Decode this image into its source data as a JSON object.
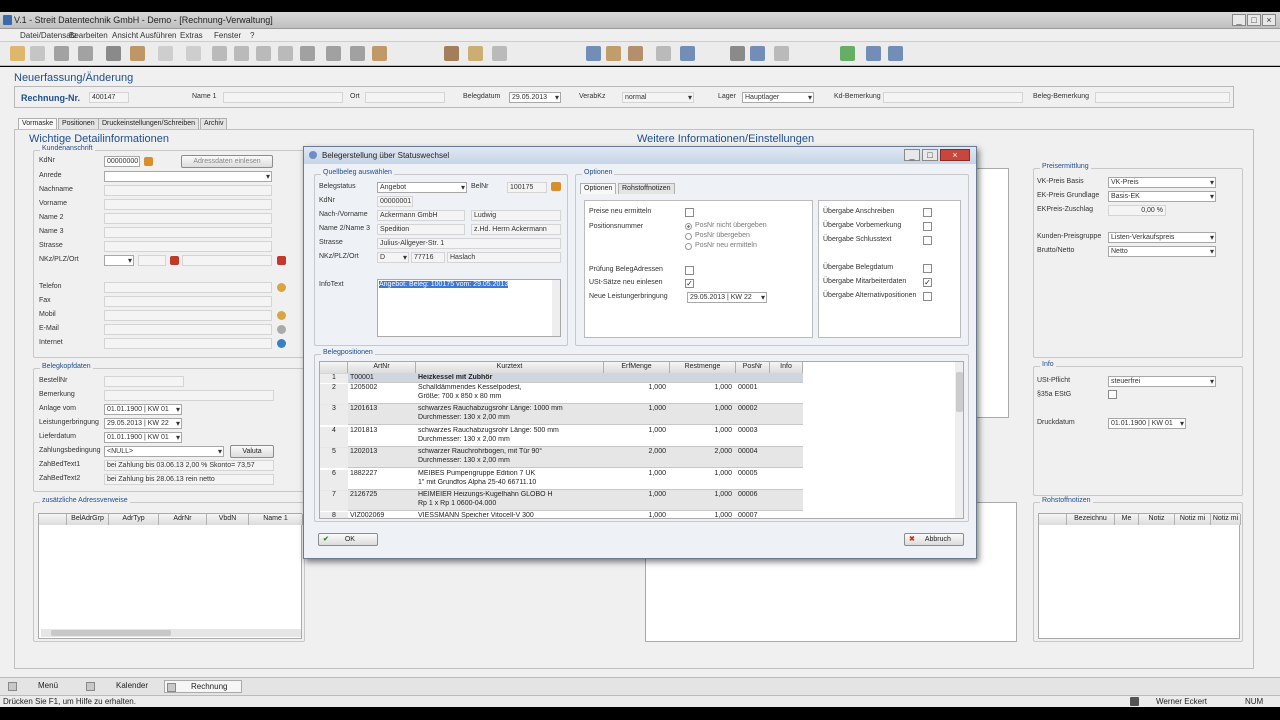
{
  "window": {
    "title": "V.1 - Streit Datentechnik GmbH - Demo - [Rechnung-Verwaltung]"
  },
  "menu": [
    "Datei/Datensatz",
    "Bearbeiten",
    "Ansicht",
    "Ausführen",
    "Extras",
    "Fenster",
    "?"
  ],
  "page": {
    "heading": "Neuerfassung/Änderung",
    "rechnung_label": "Rechnung-Nr.",
    "rechnung_nr": "400147",
    "name1_label": "Name 1",
    "ort_label": "Ort",
    "belegdatum_label": "Belegdatum",
    "belegdatum": "29.05.2013",
    "verabkz_label": "VerabKz",
    "verabkz": "normal",
    "lager_label": "Lager",
    "lager": "Hauptlager",
    "kdbem_label": "Kd-Bemerkung",
    "belegbem_label": "Beleg-Bemerkung"
  },
  "tabs": [
    "Vormaske",
    "Positionen",
    "Druckeinstellungen/Schreiben",
    "Archiv"
  ],
  "left": {
    "heading": "Wichtige Detailinformationen",
    "kunden_title": "Kundenanschrift",
    "kdnr_label": "KdNr",
    "kdnr": "00000000",
    "adress_btn": "Adressdaten einlesen",
    "fields": [
      "Anrede",
      "Nachname",
      "Vorname",
      "Name 2",
      "Name 3",
      "Strasse",
      "NKz/PLZ/Ort"
    ],
    "contact": [
      "Telefon",
      "Fax",
      "Mobil",
      "E-Mail",
      "Internet"
    ],
    "beleg_title": "Belegkopfdaten",
    "bestell_label": "BestellNr",
    "bem_label": "Bemerkung",
    "anlage_label": "Anlage vom",
    "anlage": "01.01.1900 | KW 01",
    "leist_label": "Leistungerbringung",
    "leist": "29.05.2013 | KW 22",
    "liefer_label": "Lieferdatum",
    "liefer": "01.01.1900 | KW 01",
    "zahl_label": "Zahlungsbedingung",
    "zahl": "<NULL>",
    "valuta": "Valuta",
    "zbt1_label": "ZahBedText1",
    "zbt1": "bei Zahlung bis 03.06.13 2,00 % Skonto= 73,57",
    "zbt2_label": "ZahBedText2",
    "zbt2": "bei Zahlung bis 28.06.13 rein netto",
    "zus_title": "zusätzliche Adressverweise",
    "zus_cols": [
      "BelAdrGrp",
      "AdrTyp",
      "AdrNr",
      "VbdN",
      "Name 1"
    ]
  },
  "right": {
    "heading": "Weitere Informationen/Einstellungen",
    "preis_title": "Preisermittlung",
    "vk_label": "VK-Preis Basis",
    "vk": "VK-Preis",
    "ek_label": "EK-Preis Grundlage",
    "ek": "Basis-EK",
    "ekz_label": "EKPreis-Zuschlag",
    "ekz": "0,00 %",
    "kpg_label": "Kunden-Preisgruppe",
    "kpg": "Listen-Verkaufspreis",
    "bn_label": "Brutto/Netto",
    "bn": "Netto",
    "info_title": "Info",
    "ust_label": "USt-Pflicht",
    "ust": "steuerfrei",
    "estg_label": "§35a EStG",
    "druck_label": "Druckdatum",
    "druck": "01.01.1900 | KW 01",
    "roh_title": "Rohstoffnotizen",
    "roh_cols": [
      "Bezeichnu",
      "Me",
      "Notiz",
      "Notiz mi",
      "Notiz mi"
    ]
  },
  "dialog": {
    "title": "Belegerstellung über Statuswechsel",
    "quell_title": "Quellbeleg auswählen",
    "belegstatus_label": "Belegstatus",
    "belegstatus": "Angebot",
    "belnr_label": "BelNr",
    "belnr": "100175",
    "kdnr_label": "KdNr",
    "kdnr": "00000001",
    "name_label": "Nach-/Vorname",
    "nach": "Ackermann GmbH",
    "vor": "Ludwig",
    "name2_label": "Name 2/Name 3",
    "name2": "Spedition",
    "name3": "z.Hd. Herrn Ackermann",
    "strasse_label": "Strasse",
    "strasse": "Julius-Allgeyer-Str. 1",
    "plz_label": "NKz/PLZ/Ort",
    "nkz": "D",
    "plz": "77716",
    "ort": "Haslach",
    "info_label": "InfoText",
    "info": "Angebot: Beleg: 100175 vom: 29.05.2013",
    "opt_title": "Optionen",
    "opt_tabs": [
      "Optionen",
      "Rohstoffnotizen"
    ],
    "opts_left": [
      {
        "l": "Preise neu ermitteln",
        "c": ""
      },
      {
        "l": "Prüfung BelegAdressen",
        "c": ""
      },
      {
        "l": "USt-Sätze neu einlesen",
        "c": "✓"
      }
    ],
    "posnr_label": "Positionsnummer",
    "radios": [
      "PosNr nicht übergeben",
      "PosNr übergeben",
      "PosNr neu ermitteln"
    ],
    "leist_label": "Neue Leistungerbringung",
    "leist": "29.05.2013 | KW 22",
    "opts_right": [
      {
        "l": "Übergabe Anschreiben",
        "c": ""
      },
      {
        "l": "Übergabe Vorbemerkung",
        "c": ""
      },
      {
        "l": "Übergabe Schlusstext",
        "c": ""
      },
      {
        "l": "Übergabe Belegdatum",
        "c": ""
      },
      {
        "l": "Übergabe Mitarbeiterdaten",
        "c": "✓"
      },
      {
        "l": "Übergabe Alternativpositionen",
        "c": ""
      }
    ],
    "pos_title": "Belegpositionen",
    "cols": [
      "ArtNr",
      "Kurztext",
      "ErfMenge",
      "Restmenge",
      "PosNr",
      "Info"
    ],
    "rows": [
      {
        "n": "1",
        "art": "T00001",
        "t1": "Heizkessel mit Zubhör",
        "t2": "",
        "erf": "",
        "rest": "",
        "pos": "",
        "bold": true
      },
      {
        "n": "2",
        "art": "1205002",
        "t1": "Schalldämmendes Kesselpodest,",
        "t2": "Größe:  700 x 850 x 80 mm",
        "erf": "1,000",
        "rest": "1,000",
        "pos": "00001"
      },
      {
        "n": "3",
        "art": "1201613",
        "t1": "schwarzes Rauchabzugsrohr Länge: 1000 mm",
        "t2": "Durchmesser:  130 x 2,00 mm",
        "erf": "1,000",
        "rest": "1,000",
        "pos": "00002"
      },
      {
        "n": "4",
        "art": "1201813",
        "t1": "schwarzes Rauchabzugsrohr Länge:  500 mm",
        "t2": "Durchmesser:  130 x 2,00 mm",
        "erf": "1,000",
        "rest": "1,000",
        "pos": "00003"
      },
      {
        "n": "5",
        "art": "1202013",
        "t1": "schwarzer Rauchrohrbogen, mit Tür    90°",
        "t2": "Durchmesser:  130 x 2,00 mm",
        "erf": "2,000",
        "rest": "2,000",
        "pos": "00004"
      },
      {
        "n": "6",
        "art": "1882227",
        "t1": "MEIBES Pumpengruppe Edition 7 UK",
        "t2": "1\" mit Grundfos Alpha 25-40     66711.10",
        "erf": "1,000",
        "rest": "1,000",
        "pos": "00005"
      },
      {
        "n": "7",
        "art": "2126725",
        "t1": "HEIMEIER Heizungs-Kugelhahn GLOBO H",
        "t2": "Rp 1 x Rp 1           0600-04.000",
        "erf": "1,000",
        "rest": "1,000",
        "pos": "00006"
      },
      {
        "n": "8",
        "art": "VIZ002069",
        "t1": "VIESSMANN Speicher Vitocell-V 300",
        "t2": "",
        "erf": "1,000",
        "rest": "1,000",
        "pos": "00007"
      }
    ],
    "ok": "OK",
    "cancel": "Abbruch"
  },
  "taskbar": [
    "Menü",
    "Kalender",
    "Rechnung"
  ],
  "status": {
    "hint": "Drücken Sie F1, um Hilfe zu erhalten.",
    "user": "Werner Eckert",
    "num": "NUM"
  }
}
